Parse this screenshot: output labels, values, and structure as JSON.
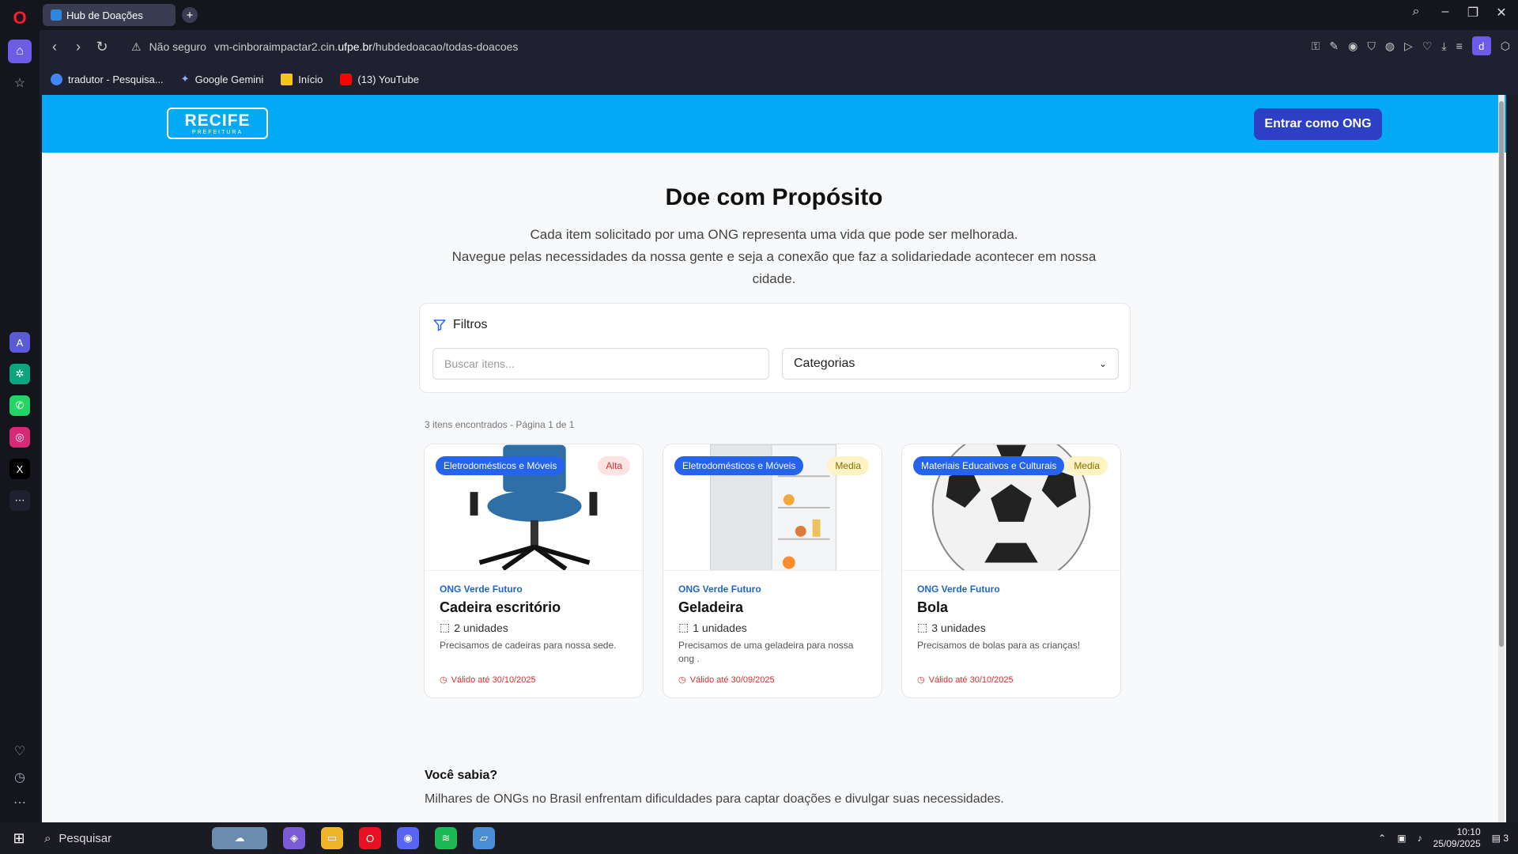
{
  "browser": {
    "tab_title": "Hub de Doações",
    "new_tab": "+",
    "security": "Não seguro",
    "url_prefix": "vm-cinboraimpactar2.cin.",
    "url_host": "ufpe.br",
    "url_path": "/hubdedoacao/todas-doacoes",
    "profile_initial": "d",
    "bookmarks": [
      {
        "label": "tradutor - Pesquisa...",
        "color": "#4285f4"
      },
      {
        "label": "Google Gemini",
        "color": "#8ab4f8"
      },
      {
        "label": "Início",
        "color": "#f5c518"
      },
      {
        "label": "(13) YouTube",
        "color": "#ff0000"
      }
    ]
  },
  "header": {
    "logo_main": "RECIFE",
    "logo_sub": "PREFEITURA",
    "ong_button": "Entrar como ONG"
  },
  "hero": {
    "title": "Doe com Propósito",
    "line1": "Cada item solicitado por uma ONG representa uma vida que pode ser melhorada.",
    "line2": "Navegue pelas necessidades da nossa gente e seja a conexão que faz a solidariedade acontecer em nossa cidade."
  },
  "filters": {
    "title": "Filtros",
    "search_placeholder": "Buscar itens...",
    "category_value": "Categorias"
  },
  "results": {
    "count_text": "3 itens encontrados - Página 1 de 1"
  },
  "cards": [
    {
      "category": "Eletrodomésticos e Móveis",
      "priority": "Alta",
      "ong": "ONG Verde Futuro",
      "title": "Cadeira escritório",
      "quantity": "2 unidades",
      "description": "Precisamos de cadeiras para nossa sede.",
      "valid": "Válido até 30/10/2025"
    },
    {
      "category": "Eletrodomésticos e Móveis",
      "priority": "Media",
      "ong": "ONG Verde Futuro",
      "title": "Geladeira",
      "quantity": "1 unidades",
      "description": "Precisamos de uma geladeira para nossa ong .",
      "valid": "Válido até 30/09/2025"
    },
    {
      "category": "Materiais Educativos e Culturais",
      "priority": "Media",
      "ong": "ONG Verde Futuro",
      "title": "Bola",
      "quantity": "3 unidades",
      "description": "Precisamos de bolas para as crianças!",
      "valid": "Válido até 30/10/2025"
    }
  ],
  "info": {
    "title": "Você sabia?",
    "text": "Milhares de ONGs no Brasil enfrentam dificuldades para captar doações e divulgar suas necessidades."
  },
  "taskbar": {
    "search_label": "Pesquisar",
    "time": "10:10",
    "date": "25/09/2025",
    "notif_count": "3"
  },
  "colors": {
    "header_bg": "#03a9f4",
    "ong_button_bg": "#2d3fc4",
    "category_badge": "#2563eb",
    "valid_text": "#d32f2f"
  }
}
